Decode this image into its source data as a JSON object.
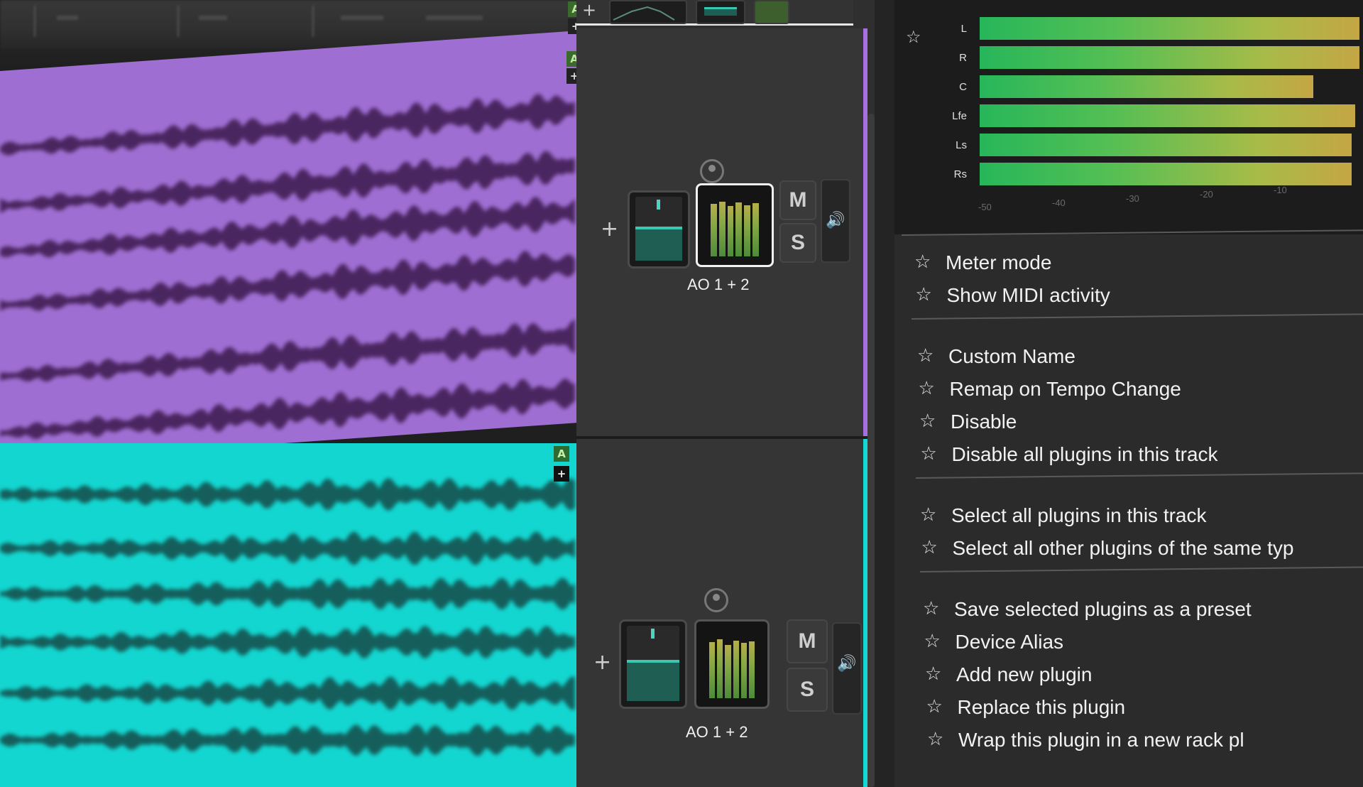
{
  "colors": {
    "track1_clip": "#9f6ed2",
    "track2_clip": "#14d6d0",
    "waveform_dark_purple": "#4a2660",
    "waveform_dark_cyan": "#155e5b",
    "meter_green": "#27b65a",
    "meter_yellow": "#c4a644"
  },
  "clips": {
    "flag_a": "A",
    "flag_plus": "+"
  },
  "tracks": [
    {
      "route": "AO 1 + 2",
      "mute_label": "M",
      "solo_label": "S",
      "add_icon": "+",
      "speaker_icon": "🔊"
    },
    {
      "route": "AO 1 + 2",
      "mute_label": "M",
      "solo_label": "S",
      "add_icon": "+",
      "speaker_icon": "🔊"
    }
  ],
  "meter_panel": {
    "star_icon": "☆",
    "channels": [
      {
        "label": "L",
        "level": 0.99
      },
      {
        "label": "R",
        "level": 0.99
      },
      {
        "label": "C",
        "level": 0.87
      },
      {
        "label": "Lfe",
        "level": 0.98
      },
      {
        "label": "Ls",
        "level": 0.97
      },
      {
        "label": "Rs",
        "level": 0.97
      }
    ],
    "scale": [
      "-50",
      "-40",
      "-30",
      "-20",
      "-10"
    ]
  },
  "context_menu": {
    "groups": [
      [
        "Meter mode",
        "Show MIDI activity"
      ],
      [
        "Custom Name",
        "Remap on Tempo Change",
        "Disable",
        "Disable all plugins in this track"
      ],
      [
        "Select all plugins in this track",
        "Select all other plugins of the same typ"
      ],
      [
        "Save selected plugins as a preset",
        "Device Alias",
        "Add new plugin",
        "Replace this plugin",
        "Wrap this plugin in a new rack pl"
      ]
    ],
    "star_icon": "☆"
  }
}
